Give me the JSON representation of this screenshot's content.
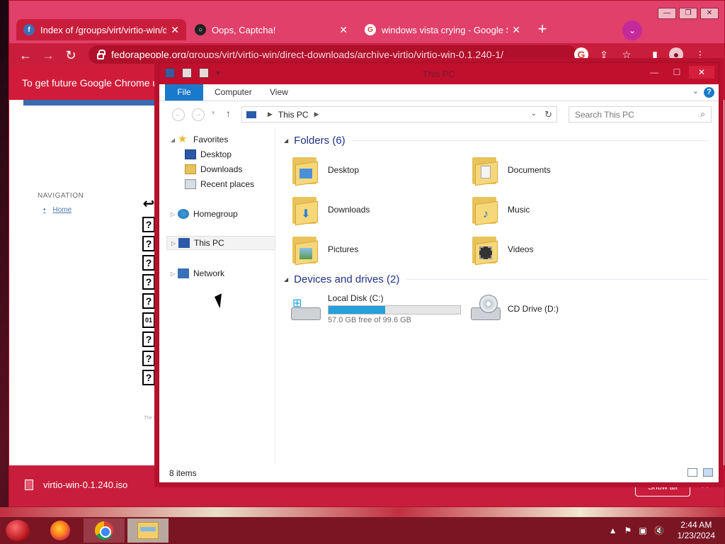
{
  "browser": {
    "tabs": [
      {
        "title": "Index of /groups/virt/virtio-win/d",
        "active": true
      },
      {
        "title": "Oops, Captcha!",
        "active": false
      },
      {
        "title": "windows vista crying - Google S",
        "active": false
      }
    ],
    "url_host": "fedorapeople.org",
    "url_path": "/groups/virt/virtio-win/direct-downloads/archive-virtio/virtio-win-0.1.240-1/",
    "infobar_text": "To get future Google Chrome upd",
    "page": {
      "navigation_heading": "NAVIGATION",
      "home_link": "Home",
      "footer": "The F"
    },
    "download": {
      "filename": "virtio-win-0.1.240.iso",
      "more": "^",
      "show_all": "Show all"
    },
    "colors": {
      "accent": "#c81e3c",
      "tabstrip": "#e0406a"
    }
  },
  "explorer": {
    "title": "This PC",
    "ribbon_tabs": [
      "File",
      "Computer",
      "View"
    ],
    "address": "This PC",
    "search_placeholder": "Search This PC",
    "nav": {
      "favorites": "Favorites",
      "desktop": "Desktop",
      "downloads": "Downloads",
      "recent": "Recent places",
      "homegroup": "Homegroup",
      "thispc": "This PC",
      "network": "Network"
    },
    "folders_header": "Folders (6)",
    "folders": [
      {
        "name": "Desktop",
        "icon": "desktop-folder-icon"
      },
      {
        "name": "Documents",
        "icon": "documents-folder-icon"
      },
      {
        "name": "Downloads",
        "icon": "downloads-folder-icon"
      },
      {
        "name": "Music",
        "icon": "music-folder-icon"
      },
      {
        "name": "Pictures",
        "icon": "pictures-folder-icon"
      },
      {
        "name": "Videos",
        "icon": "videos-folder-icon"
      }
    ],
    "devices_header": "Devices and drives (2)",
    "drives": [
      {
        "name": "Local Disk (C:)",
        "free_text": "57.0 GB free of 99.6 GB",
        "used_fraction": 0.43
      },
      {
        "name": "CD Drive (D:)"
      }
    ],
    "status": "8 items"
  },
  "taskbar": {
    "time": "2:44 AM",
    "date": "1/23/2024"
  }
}
